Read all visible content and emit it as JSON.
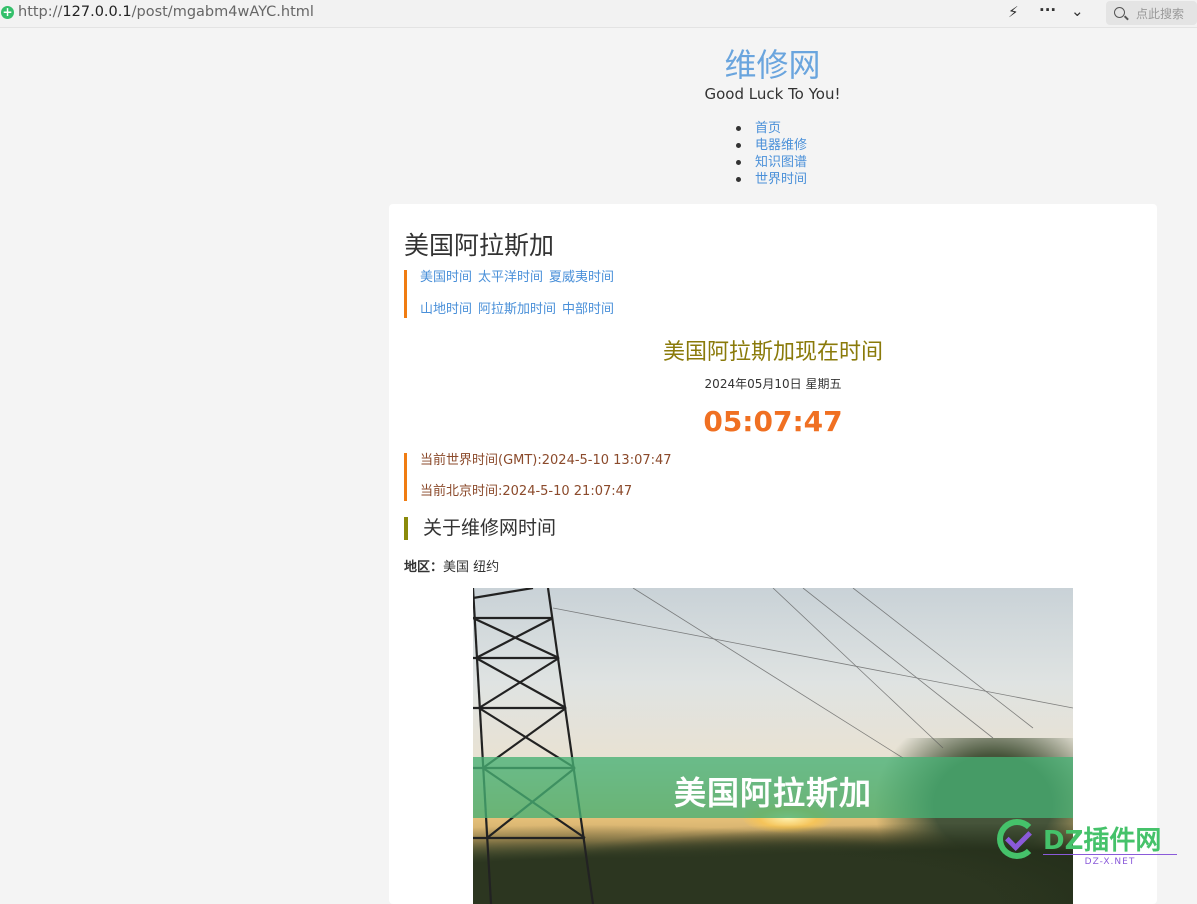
{
  "browser": {
    "url_scheme": "http://",
    "url_host": "127.0.0.1",
    "url_path": "/post/mgabm4wAYC.html",
    "search_placeholder": "点此搜索"
  },
  "site": {
    "title": "维修网",
    "tagline": "Good Luck To You!",
    "nav": [
      "首页",
      "电器维修",
      "知识图谱",
      "世界时间"
    ]
  },
  "post": {
    "title": "美国阿拉斯加",
    "timezone_links_row1": [
      "美国时间",
      "太平洋时间",
      "夏威夷时间"
    ],
    "timezone_links_row2": [
      "山地时间",
      "阿拉斯加时间",
      "中部时间"
    ],
    "now_title": "美国阿拉斯加现在时间",
    "date": "2024年05月10日 星期五",
    "clock": "05:07:47",
    "gmt_line": "当前世界时间(GMT):2024-5-10 13:07:47",
    "beijing_line": "当前北京时间:2024-5-10 21:07:47",
    "about_heading": "关于维修网时间",
    "region_label": "地区：",
    "region_value": "美国 纽约",
    "image_banner": "美国阿拉斯加"
  },
  "watermark": {
    "text": "DZ插件网",
    "sub": "DZ-X.NET"
  },
  "colors": {
    "link": "#4a90d9",
    "accent_bar": "#f07c12",
    "clock": "#f07022",
    "now_title": "#8a7a0a",
    "site_title": "#6aa5de"
  }
}
